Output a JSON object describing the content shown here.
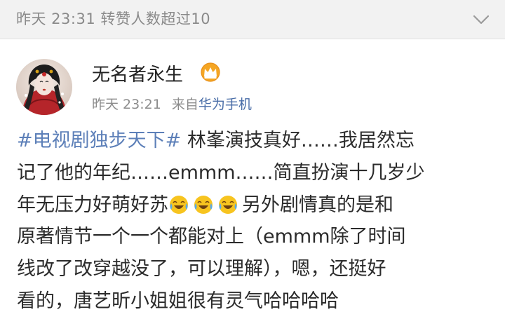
{
  "header": {
    "notice": "昨天 23:31 转赞人数超过10"
  },
  "post": {
    "user_name": "无名者永生",
    "time": "昨天 23:21",
    "source_prefix": "来自",
    "source_device": "华为手机",
    "topic": "#电视剧独步天下#",
    "lines": [
      " 林峯演技真好……我居然忘",
      "记了他的年纪……emmm……简直扮演十几岁少",
      "年无压力好萌好苏",
      "另外剧情真的是和",
      "原著情节一个一个都能对上（emmm除了时间",
      "线改了改穿越没了，可以理解），嗯，还挺好",
      "看的，唐艺昕小姐姐很有灵气哈哈哈哈"
    ],
    "emoji_names": [
      "laugh-cry-icon",
      "laugh-cry-icon",
      "laugh-cry-icon"
    ]
  },
  "icons": {
    "expand": "chevron-down-icon",
    "member_badge": "crown-icon"
  },
  "colors": {
    "header_bg": "#f2f2f2",
    "link": "#5c7fb8",
    "meta_text": "#8c8c8c",
    "body_text": "#2b2b2b"
  }
}
